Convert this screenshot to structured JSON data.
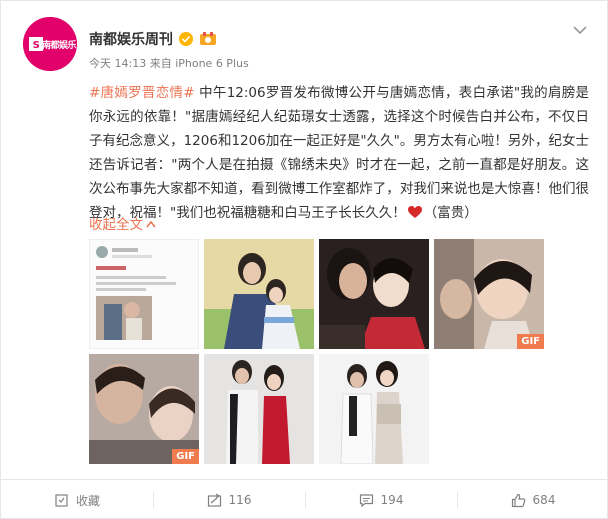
{
  "post": {
    "author": "南都娱乐周刊",
    "avatar_text": "南都娱乐",
    "meta": "今天 14:13 来自 iPhone 6 Plus",
    "topic": "#唐嫣罗晋恋情#",
    "text": " 中午12:06罗晋发布微博公开与唐嫣恋情，表白承诺\"我的肩膀是你永远的依靠！\"据唐嫣经纪人纪茹璟女士透露，选择这个时候告白并公布，不仅日子有纪念意义，1206和1206加在一起正好是\"久久\"。男方太有心啦！另外，纪女士还告诉记者：\"两个人是在拍摄《锦绣未央》时才在一起，之前一直都是好朋友。这次公布事先大家都不知道，看到微博工作室都炸了，对我们来说也是大惊喜！他们很登对，祝福！\"我们也祝福糖糖和白马王子长长久久！",
    "text_end": "（富贵）",
    "collapse_label": "收起全文",
    "gif_label": "GIF"
  },
  "actions": {
    "favorite": "收藏",
    "repost": "116",
    "comment": "194",
    "like": "684"
  },
  "colors": {
    "accent": "#eb7350",
    "brand": "#e2006a",
    "verified": "#ffb400",
    "heart": "#d62a2a"
  },
  "icons": [
    "chevron-down-icon",
    "verified-icon",
    "level-badge-icon",
    "heart-icon",
    "favorite-icon",
    "repost-icon",
    "comment-icon",
    "like-icon"
  ]
}
